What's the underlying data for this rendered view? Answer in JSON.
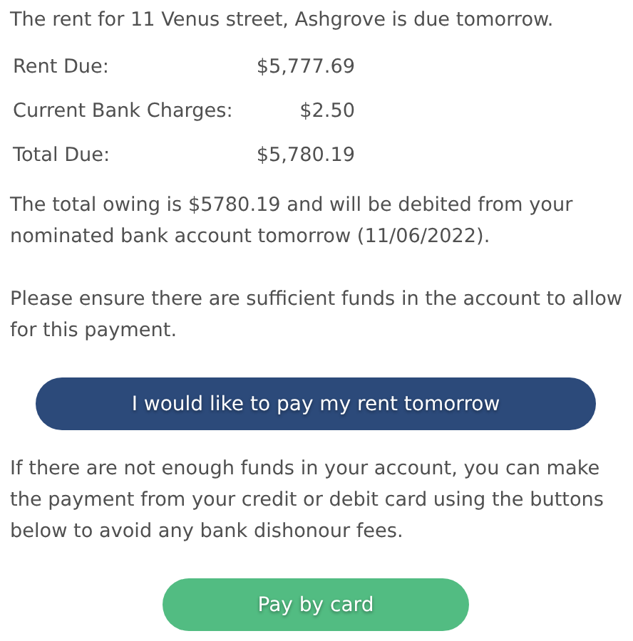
{
  "intro": "The rent for 11 Venus street, Ashgrove is due tomorrow.",
  "charges": [
    {
      "label": "Rent Due:",
      "amount": "$5,777.69"
    },
    {
      "label": "Current Bank Charges:",
      "amount": "$2.50"
    },
    {
      "label": "Total Due:",
      "amount": "$5,780.19"
    }
  ],
  "debit_note": "The total owing is $5780.19 and will be debited from your nominated bank account tomorrow (11/06/2022).",
  "funds_note": "Please ensure there are sufficient funds in the account to allow for this payment.",
  "primary_button": "I would like to pay my rent tomorrow",
  "card_note": "If there are not enough funds in your account, you can make the payment from your credit or debit card using the buttons below to avoid any bank dishonour fees.",
  "card_button": "Pay by card"
}
